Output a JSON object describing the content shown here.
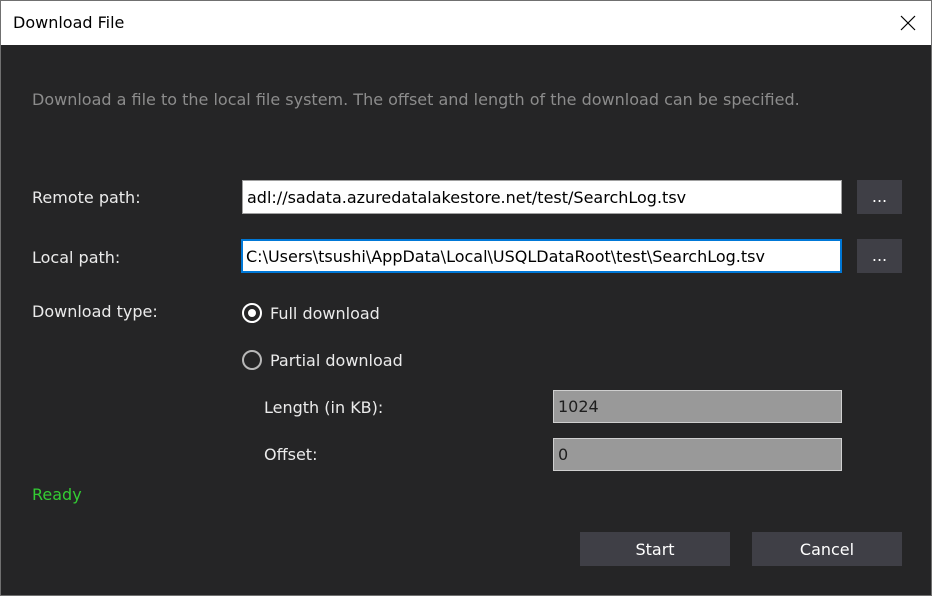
{
  "window": {
    "title": "Download File",
    "close_icon": "close-icon"
  },
  "description": "Download a file to the local file system. The offset and length of the download can be specified.",
  "remote": {
    "label": "Remote path:",
    "value": "adl://sadata.azuredatalakestore.net/test/SearchLog.tsv",
    "browse_label": "..."
  },
  "local": {
    "label": "Local path:",
    "value": "C:\\Users\\tsushi\\AppData\\Local\\USQLDataRoot\\test\\SearchLog.tsv",
    "browse_label": "..."
  },
  "download_type": {
    "label": "Download type:",
    "options": [
      {
        "label": "Full download",
        "selected": true
      },
      {
        "label": "Partial download",
        "selected": false
      }
    ]
  },
  "partial": {
    "length_label": "Length (in KB):",
    "length_value": "1024",
    "offset_label": "Offset:",
    "offset_value": "0"
  },
  "status": {
    "text": "Ready",
    "color": "#33cc33"
  },
  "actions": {
    "start_label": "Start",
    "cancel_label": "Cancel"
  },
  "colors": {
    "background": "#252526",
    "button": "#3f3f46",
    "focus_border": "#0078d7",
    "disabled_input": "#999999"
  }
}
